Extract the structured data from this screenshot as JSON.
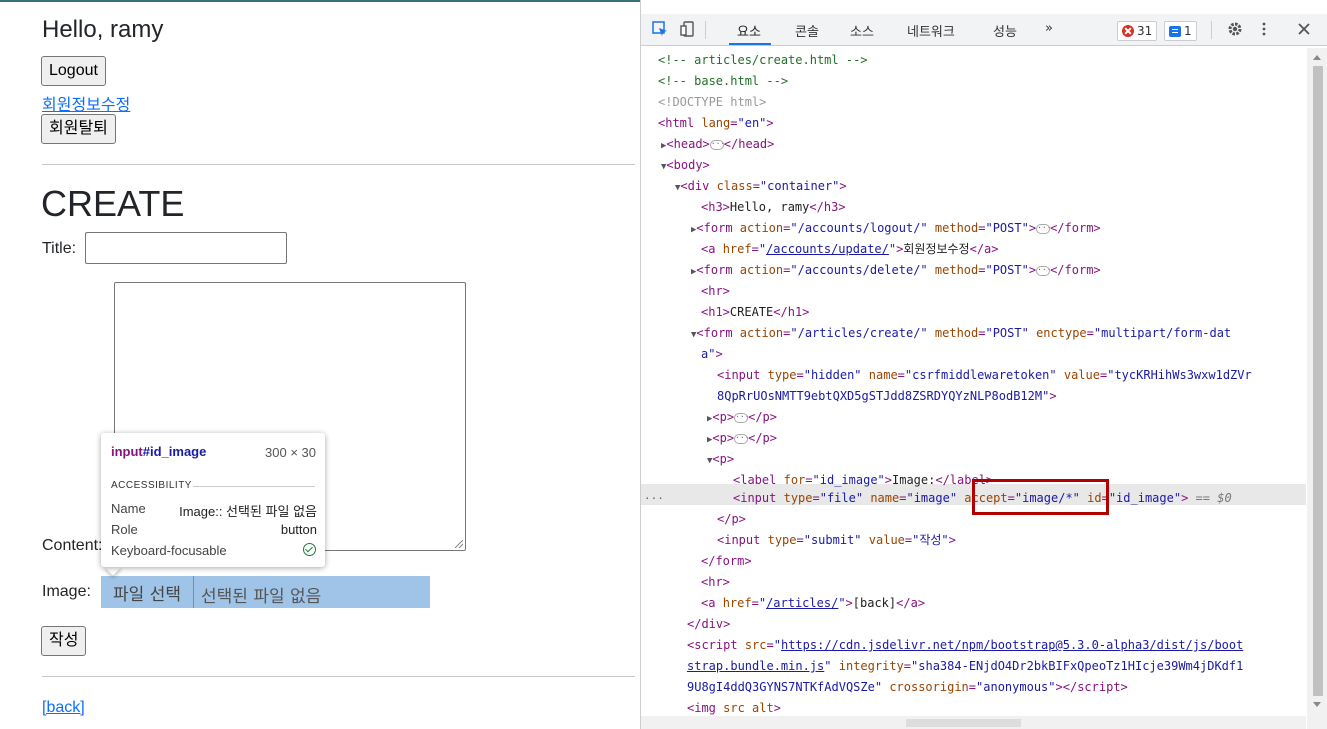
{
  "page": {
    "greeting": "Hello, ramy",
    "logout_label": "Logout",
    "update_link": "회원정보수정",
    "delete_label": "회원탈퇴",
    "heading": "CREATE",
    "title_label": "Title:",
    "content_label": "Content:",
    "image_label": "Image:",
    "file_button": "파일 선택",
    "file_status": "선택된 파일 없음",
    "submit_label": "작성",
    "back_link": "[back]"
  },
  "tooltip": {
    "element_tag": "input",
    "element_id": "#id_image",
    "size": "300 × 30",
    "section": "ACCESSIBILITY",
    "rows": [
      {
        "key": "Name",
        "value": "Image:: 선택된 파일 없음"
      },
      {
        "key": "Role",
        "value": "button"
      },
      {
        "key": "Keyboard-focusable",
        "value": ""
      }
    ]
  },
  "devtools": {
    "tabs": [
      "요소",
      "콘솔",
      "소스",
      "네트워크",
      "성능",
      "»"
    ],
    "active_tab": "요소",
    "error_count": "31",
    "message_count": "1",
    "selected_suffix": "== $0",
    "accent_color": "#1a73e8",
    "highlight_color": "#b00000"
  }
}
